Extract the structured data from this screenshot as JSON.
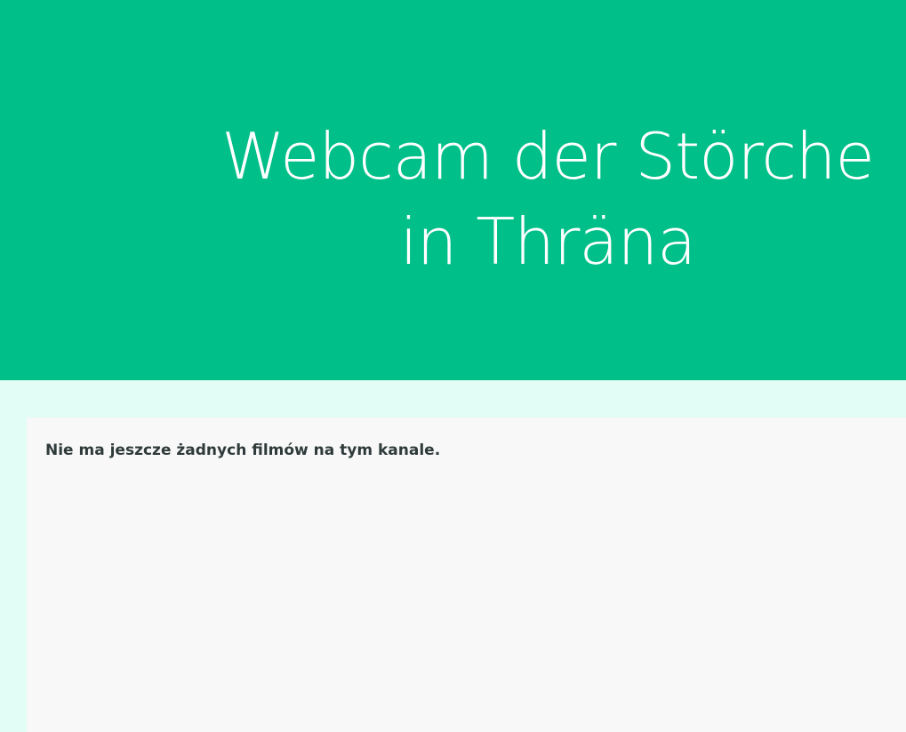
{
  "header": {
    "title_line_1": "Webcam der Störche",
    "title_line_2": "in Thräna",
    "background_color": "#00bf89"
  },
  "main": {
    "empty_message": "Nie ma jeszcze żadnych filmów na tym kanale."
  }
}
